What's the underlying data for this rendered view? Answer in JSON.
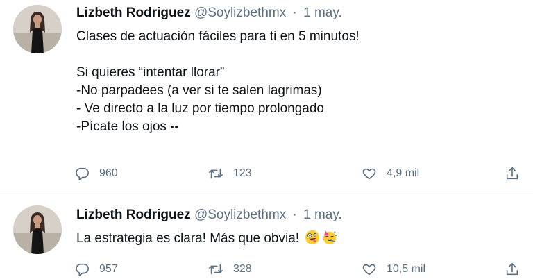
{
  "tweets": [
    {
      "author_name": "Lizbeth Rodriguez",
      "handle": "@Soylizbethmx",
      "separator": "·",
      "date": "1 may.",
      "lines": [
        "Clases de actuación fáciles para ti en 5 minutos!",
        "",
        "Si quieres “intentar llorar”",
        "-No parpadees (a ver si te salen lagrimas)",
        "- Ve directo a la luz por tiempo prolongado",
        "-Pícate  los ojos"
      ],
      "trailing_emoji": "••",
      "replies": "960",
      "retweets": "123",
      "likes": "4,9 mil"
    },
    {
      "author_name": "Lizbeth Rodriguez",
      "handle": "@Soylizbethmx",
      "separator": "·",
      "date": "1 may.",
      "lines": [
        "La estrategia es clara! Más que obvia!"
      ],
      "emojis": [
        "zany-face-emoji",
        "partying-face-emoji"
      ],
      "replies": "957",
      "retweets": "328",
      "likes": "10,5 mil"
    }
  ],
  "icons": {
    "reply": "reply-icon",
    "retweet": "retweet-icon",
    "like": "heart-icon",
    "share": "share-icon"
  },
  "colors": {
    "text": "#0f1419",
    "secondary": "#5b7083",
    "divider": "#e6ecf0"
  }
}
